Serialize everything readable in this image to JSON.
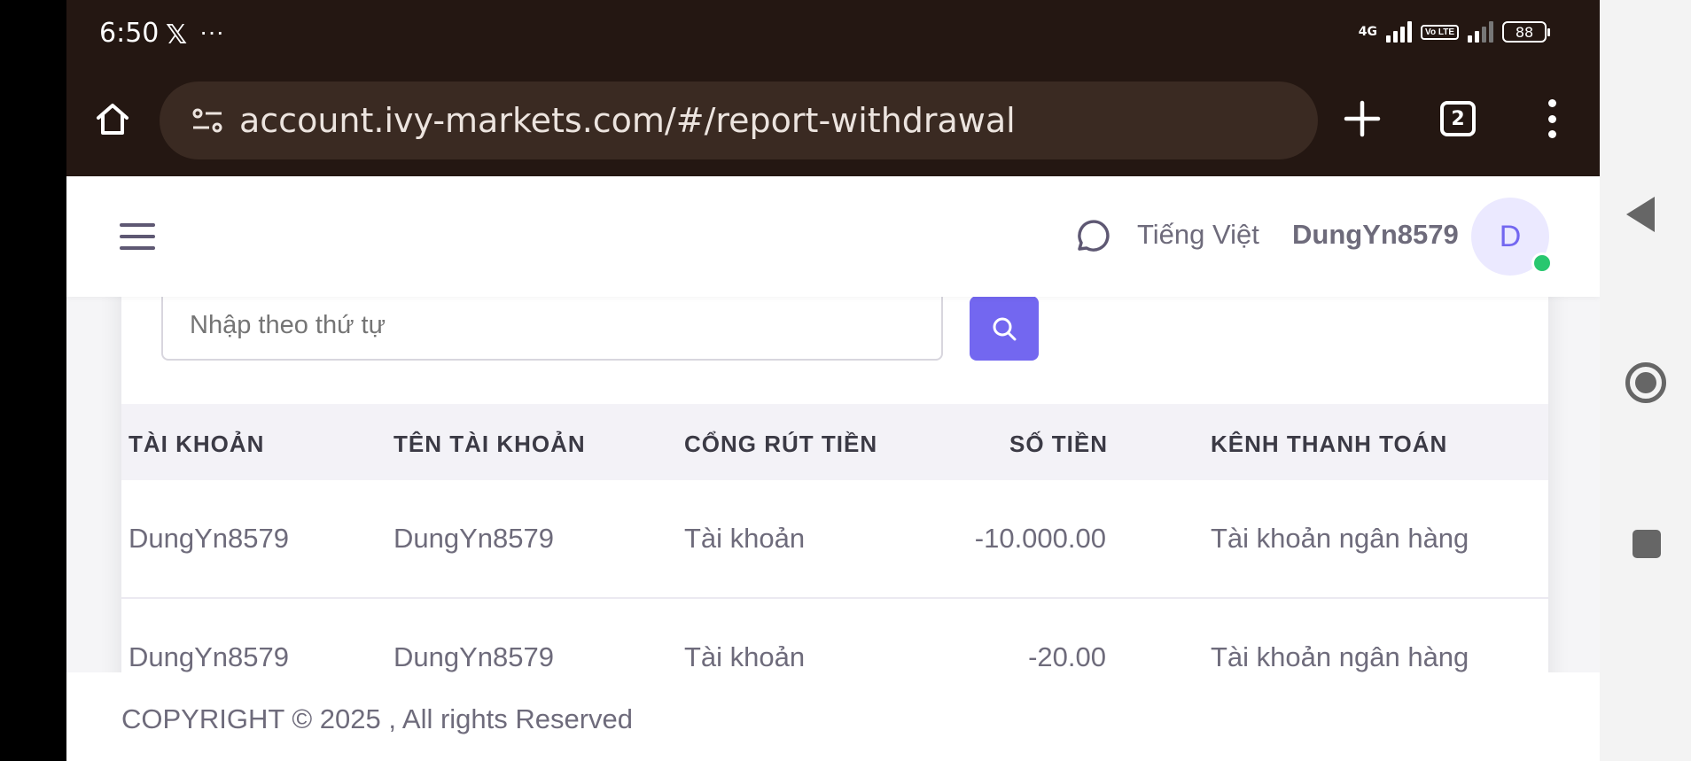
{
  "status_bar": {
    "time": "6:50",
    "app_icon": "x-logo-icon",
    "network_label": "4G",
    "volte_label": "Vo LTE",
    "battery": "88"
  },
  "browser": {
    "url": "account.ivy-markets.com/#/report-withdrawal",
    "tab_count": "2",
    "icons": [
      "home-icon",
      "site-info-icon",
      "new-tab-plus-icon",
      "tab-switcher-icon",
      "kebab-menu-icon"
    ]
  },
  "header": {
    "language": "Tiếng Việt",
    "username": "DungYn8579",
    "avatar_initial": "D",
    "online_color": "#28c76f"
  },
  "search": {
    "placeholder": "Nhập theo thứ tự",
    "button_color": "#7367f0"
  },
  "table": {
    "columns": [
      "TÀI KHOẢN",
      "TÊN TÀI KHOẢN",
      "CỔNG RÚT TIỀN",
      "SỐ TIỀN",
      "KÊNH THANH TOÁN"
    ],
    "rows": [
      [
        "DungYn8579",
        "DungYn8579",
        "Tài khoản",
        "-10.000.00",
        "Tài khoản ngân hàng"
      ],
      [
        "DungYn8579",
        "DungYn8579",
        "Tài khoản",
        "-20.00",
        "Tài khoản ngân hàng"
      ]
    ]
  },
  "footer": {
    "copyright": "COPYRIGHT © 2025 , All rights Reserved"
  }
}
